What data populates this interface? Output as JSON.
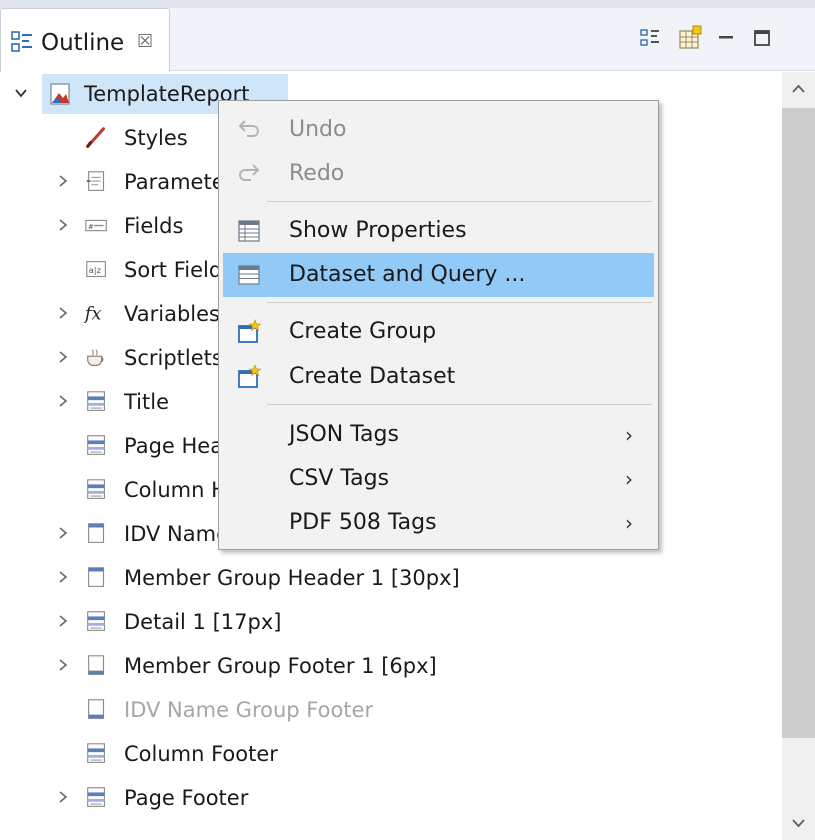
{
  "tab": {
    "title": "Outline",
    "close_glyph": "☒"
  },
  "toolbar": {
    "buttons": [
      {
        "name": "tree-layout-icon"
      },
      {
        "name": "element-palette-icon"
      },
      {
        "name": "minimize-icon"
      },
      {
        "name": "maximize-icon"
      }
    ]
  },
  "tree": {
    "root": {
      "label": "TemplateReport",
      "icon": "report-icon"
    },
    "items": [
      {
        "label": "Styles",
        "icon": "styles-brush-icon",
        "expandable": false,
        "dim": false
      },
      {
        "label": "Parameters",
        "icon": "parameters-icon",
        "expandable": true,
        "dim": false
      },
      {
        "label": "Fields",
        "icon": "fields-icon",
        "expandable": true,
        "dim": false
      },
      {
        "label": "Sort Fields",
        "icon": "sort-fields-icon",
        "expandable": false,
        "dim": false
      },
      {
        "label": "Variables",
        "icon": "variables-fx-icon",
        "expandable": true,
        "dim": false
      },
      {
        "label": "Scriptlets",
        "icon": "scriptlets-icon",
        "expandable": true,
        "dim": false
      },
      {
        "label": "Title",
        "icon": "band-icon",
        "expandable": true,
        "dim": false
      },
      {
        "label": "Page Header",
        "icon": "band-icon",
        "expandable": false,
        "dim": false
      },
      {
        "label": "Column Header",
        "icon": "band-icon",
        "expandable": false,
        "dim": false
      },
      {
        "label": "IDV Name Group Header",
        "icon": "group-header-icon",
        "expandable": true,
        "dim": false
      },
      {
        "label": "Member Group Header 1 [30px]",
        "icon": "group-header-icon",
        "expandable": true,
        "dim": false
      },
      {
        "label": "Detail 1 [17px]",
        "icon": "band-icon",
        "expandable": true,
        "dim": false
      },
      {
        "label": "Member Group Footer 1 [6px]",
        "icon": "group-footer-icon",
        "expandable": true,
        "dim": false
      },
      {
        "label": "IDV Name Group Footer",
        "icon": "group-footer-icon",
        "expandable": false,
        "dim": true
      },
      {
        "label": "Column Footer",
        "icon": "band-icon",
        "expandable": false,
        "dim": false
      },
      {
        "label": "Page Footer",
        "icon": "band-icon",
        "expandable": true,
        "dim": false
      }
    ]
  },
  "context_menu": {
    "items": [
      {
        "label": "Undo",
        "icon": "undo-icon",
        "disabled": true,
        "submenu": false
      },
      {
        "label": "Redo",
        "icon": "redo-icon",
        "disabled": true,
        "submenu": false
      },
      {
        "label": "Show Properties",
        "icon": "properties-icon",
        "disabled": false,
        "submenu": false
      },
      {
        "label": "Dataset and Query ...",
        "icon": "dataset-query-icon",
        "disabled": false,
        "submenu": false,
        "hover": true
      },
      {
        "label": "Create Group",
        "icon": "create-group-icon",
        "disabled": false,
        "submenu": false
      },
      {
        "label": "Create Dataset",
        "icon": "create-dataset-icon",
        "disabled": false,
        "submenu": false
      },
      {
        "label": "JSON Tags",
        "icon": "",
        "disabled": false,
        "submenu": true
      },
      {
        "label": "CSV Tags",
        "icon": "",
        "disabled": false,
        "submenu": true
      },
      {
        "label": "PDF 508 Tags",
        "icon": "",
        "disabled": false,
        "submenu": true
      }
    ],
    "submenu_arrow": "›"
  },
  "colors": {
    "selection": "#cfe5f8",
    "menu_hover": "#91c9f7",
    "menu_bg": "#f2f2f2",
    "band_icon": "#5b7fb8"
  }
}
